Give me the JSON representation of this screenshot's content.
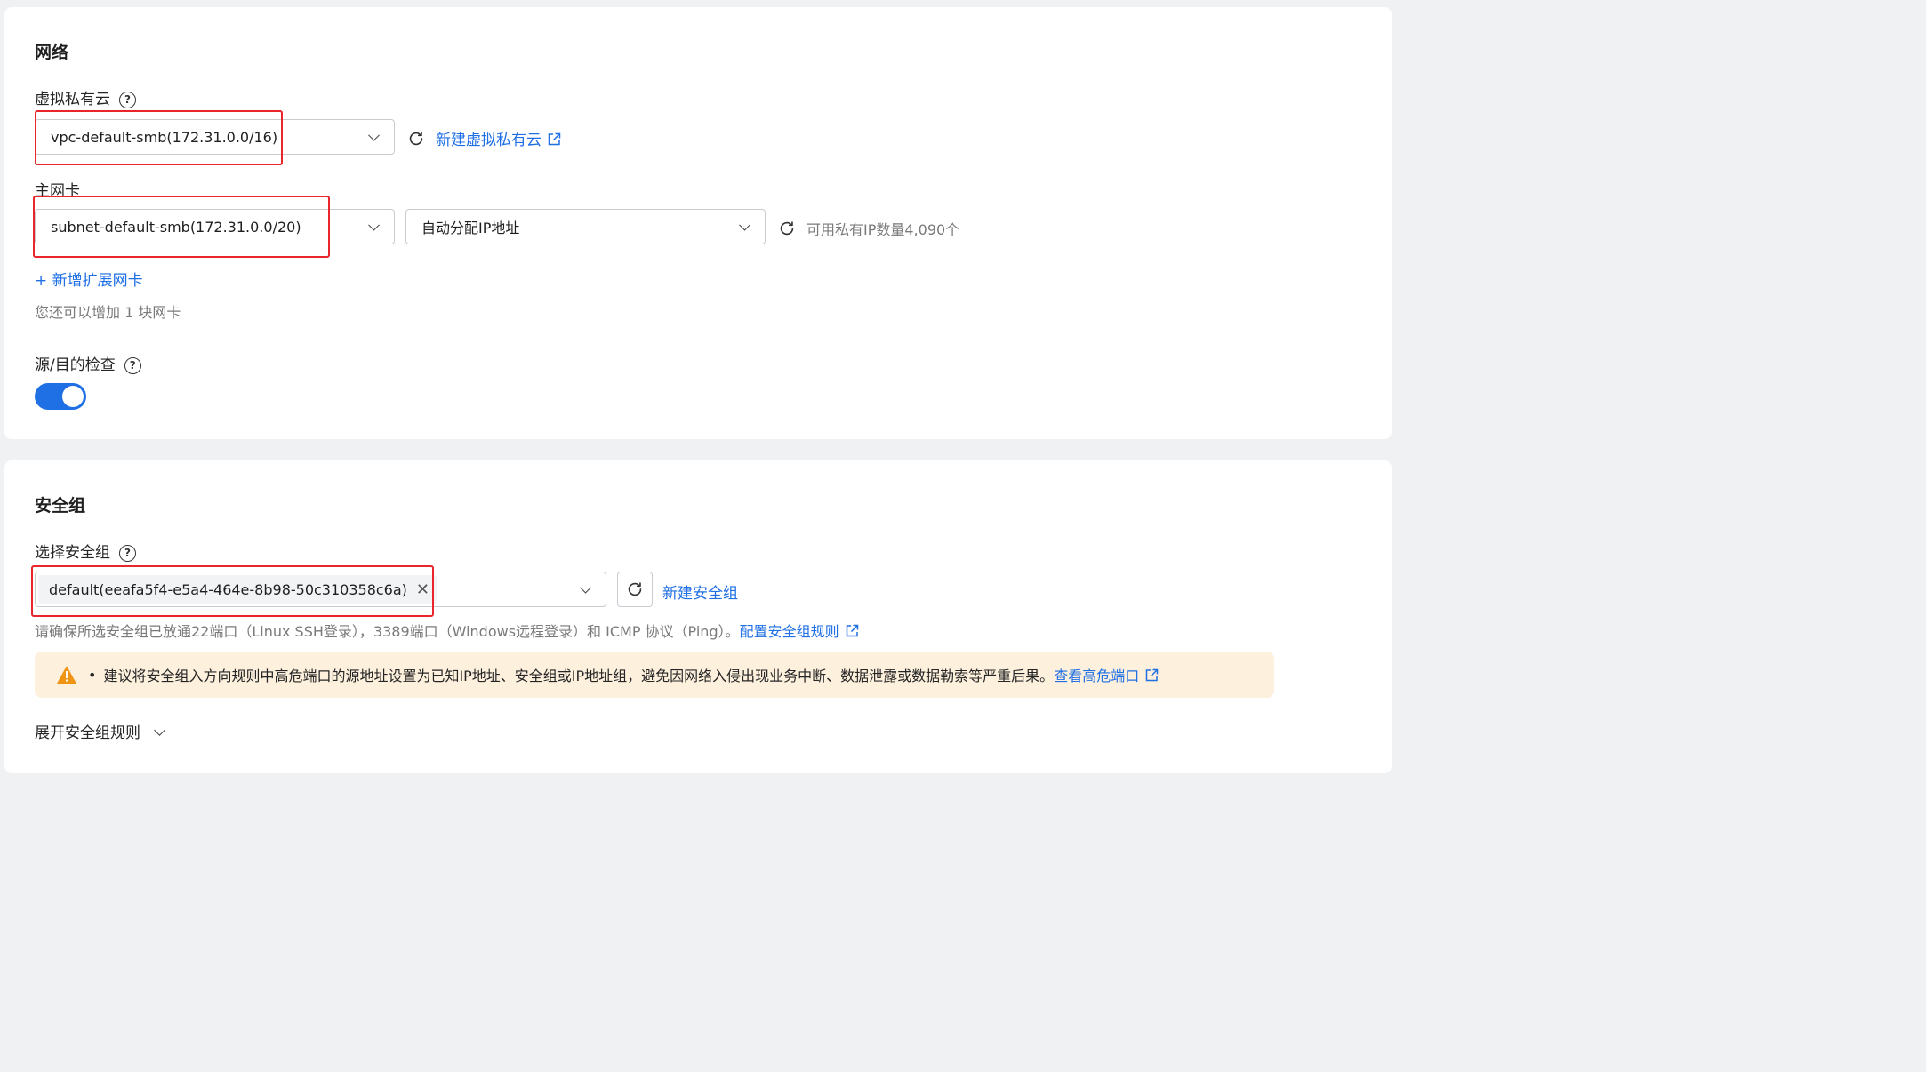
{
  "network": {
    "title": "网络",
    "vpc_label": "虚拟私有云",
    "vpc_value": "vpc-default-smb(172.31.0.0/16)",
    "new_vpc_link": "新建虚拟私有云",
    "nic_label": "主网卡",
    "subnet_value": "subnet-default-smb(172.31.0.0/20)",
    "ip_mode_value": "自动分配IP地址",
    "available_ip_text": "可用私有IP数量4,090个",
    "add_nic_link": "+ 新增扩展网卡",
    "add_nic_hint": "您还可以增加 1 块网卡",
    "src_dst_check_label": "源/目的检查",
    "src_dst_check_on": true
  },
  "security_group": {
    "title": "安全组",
    "select_label": "选择安全组",
    "selected_tag": "default(eeafa5f4-e5a4-464e-8b98-50c310358c6a)",
    "new_sg_link": "新建安全组",
    "port_hint": "请确保所选安全组已放通22端口（Linux SSH登录），3389端口（Windows远程登录）和 ICMP 协议（Ping）。",
    "config_rules_link": "配置安全组规则",
    "warning_text": "建议将安全组入方向规则中高危端口的源地址设置为已知IP地址、安全组或IP地址组，避免因网络入侵出现业务中断、数据泄露或数据勒索等严重后果。",
    "view_high_risk_link": "查看高危端口",
    "expand_rules": "展开安全组规则"
  },
  "colors": {
    "accent": "#1f6fe5",
    "highlight_box": "#e8262b",
    "warning_bg": "#fdf0dd",
    "warning_icon": "#f09414"
  }
}
